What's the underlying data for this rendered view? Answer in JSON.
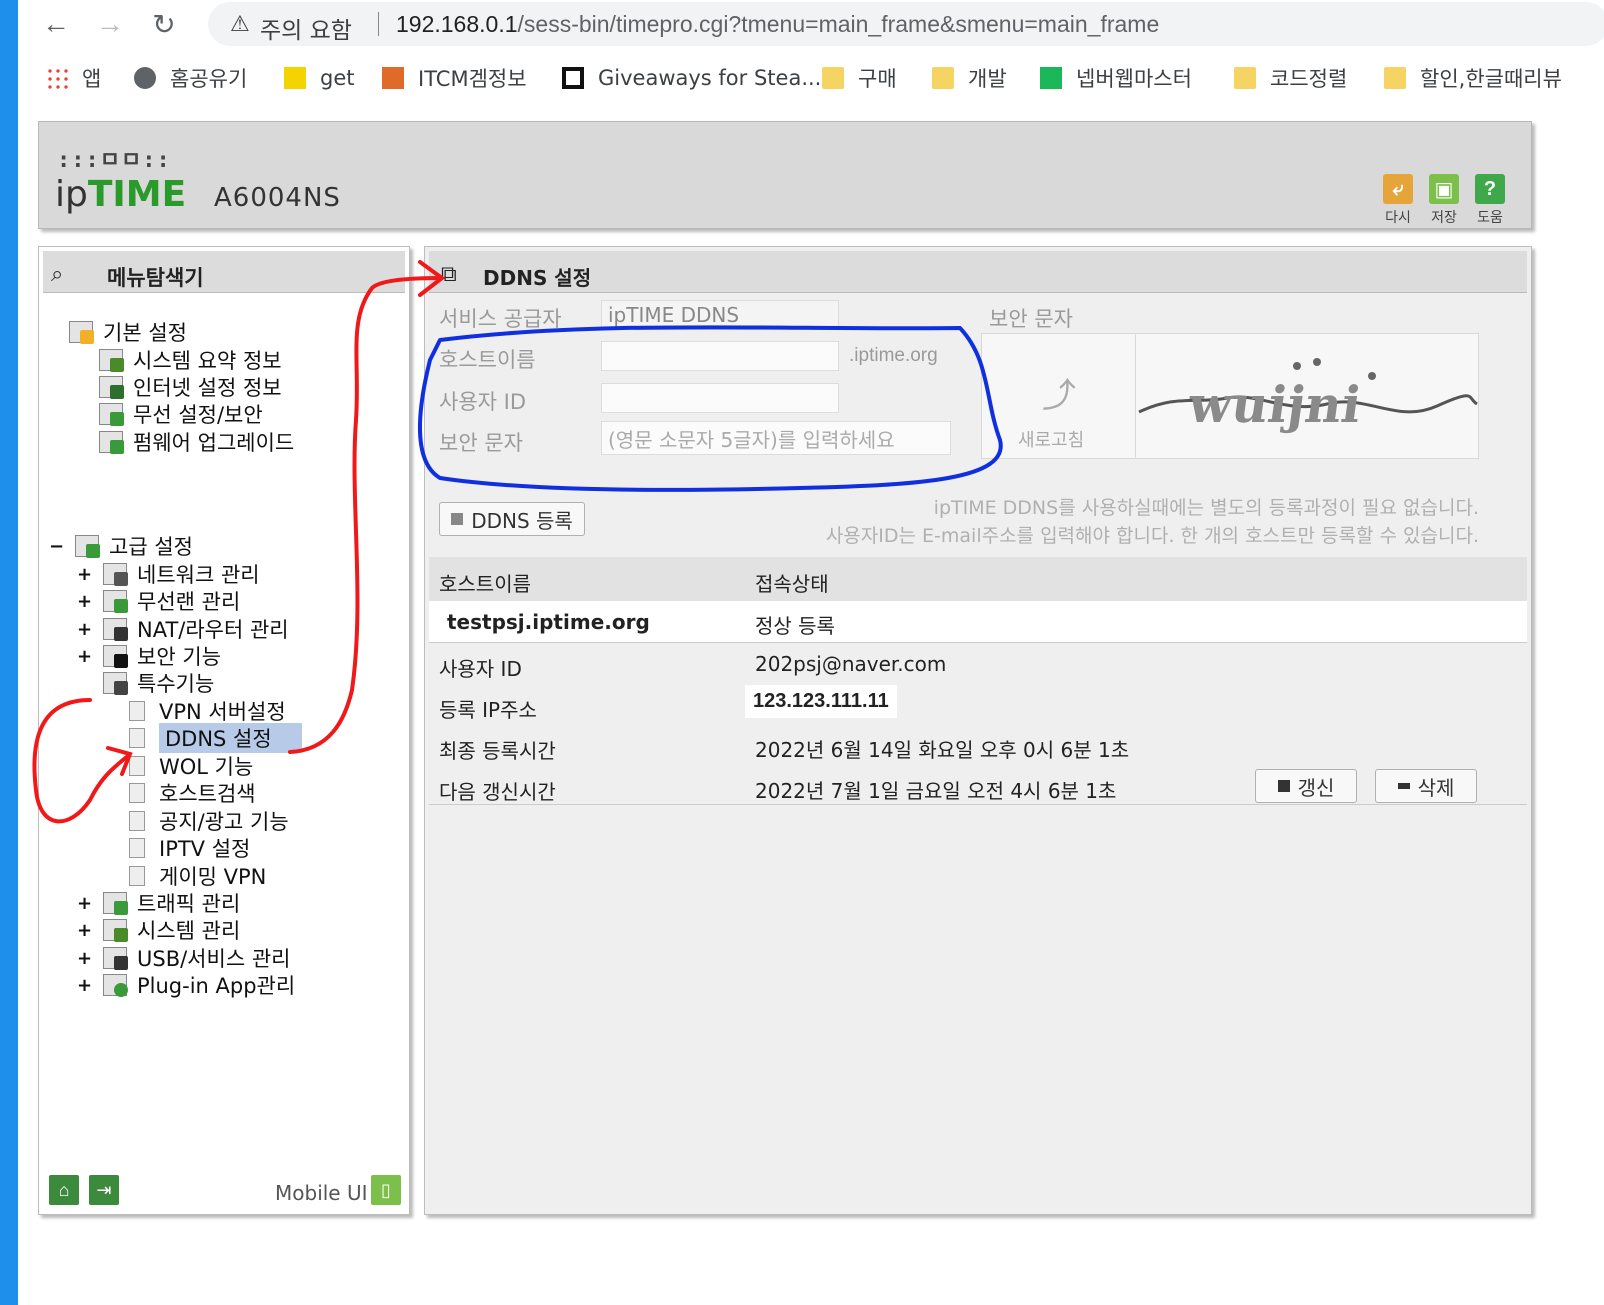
{
  "browser": {
    "address_warning": "주의 요함",
    "url_host": "192.168.0.1",
    "url_path": "/sess-bin/timepro.cgi?tmenu=main_frame&smenu=main_frame",
    "bookmarks": [
      "앱",
      "홈공유기",
      "get",
      "ITCM겜정보",
      "Giveaways for Stea...",
      "구매",
      "개발",
      "넵버웹마스터",
      "코드정렬",
      "할인,한글때리뷰"
    ]
  },
  "header": {
    "logo_dots": ":::ㅁㅁ::",
    "logo_prefix": "ip",
    "logo_brand": "TIME",
    "model": "A6004NS",
    "buttons": [
      {
        "label": "다시",
        "color": "#e6a53a"
      },
      {
        "label": "저장",
        "color": "#7cbf4a"
      },
      {
        "label": "도움",
        "color": "#3fa84a"
      }
    ]
  },
  "sidebar": {
    "title": "메뉴탐색기",
    "basic_group": "기본 설정",
    "basic_items": [
      "시스템 요약 정보",
      "인터넷 설정 정보",
      "무선 설정/보안",
      "펌웨어 업그레이드"
    ],
    "advanced_group": "고급 설정",
    "advanced_items": [
      "네트워크 관리",
      "무선랜 관리",
      "NAT/라우터 관리",
      "보안 기능",
      "특수기능"
    ],
    "special_items": [
      "VPN 서버설정",
      "DDNS 설정",
      "WOL 기능",
      "호스트검색",
      "공지/광고 기능",
      "IPTV 설정",
      "게이밍 VPN"
    ],
    "more_items": [
      "트래픽 관리",
      "시스템 관리",
      "USB/서비스 관리",
      "Plug-in App관리"
    ],
    "selected": "DDNS 설정",
    "mobile_ui": "Mobile UI"
  },
  "main": {
    "title": "DDNS 설정",
    "form": {
      "provider_label": "서비스 공급자",
      "provider_value": "ipTIME DDNS",
      "hostname_label": "호스트이름",
      "hostname_value": "",
      "hostname_suffix": ".iptime.org",
      "userid_label": "사용자 ID",
      "userid_value": "",
      "captcha_label": "보안 문자",
      "captcha_placeholder": "(영문 소문자 5글자)를 입력하세요"
    },
    "captcha": {
      "title": "보안 문자",
      "refresh_label": "새로고침",
      "text": "wuijni"
    },
    "register_button": "DDNS 등록",
    "note_line1": "ipTIME DDNS를 사용하실때에는 별도의 등록과정이 필요 없습니다.",
    "note_line2": "사용자ID는 E-mail주소를 입력해야 합니다. 한 개의 호스트만 등록할 수 있습니다.",
    "table": {
      "col_host": "호스트이름",
      "col_status": "접속상태",
      "host": "testpsj.iptime.org",
      "status": "정상 등록"
    },
    "info": {
      "userid_label": "사용자 ID",
      "userid_value": "202psj@naver.com",
      "ip_label": "등록 IP주소",
      "ip_value": "123.123.111.11",
      "last_label": "최종 등록시간",
      "last_value": "2022년 6월 14일 화요일 오후 0시 6분 1초",
      "next_label": "다음 갱신시간",
      "next_value": "2022년 7월 1일 금요일 오전 4시 6분 1초"
    },
    "renew_button": "갱신",
    "delete_button": "삭제"
  },
  "annotation_colors": {
    "red": "#f01818",
    "blue": "#1030e0"
  }
}
